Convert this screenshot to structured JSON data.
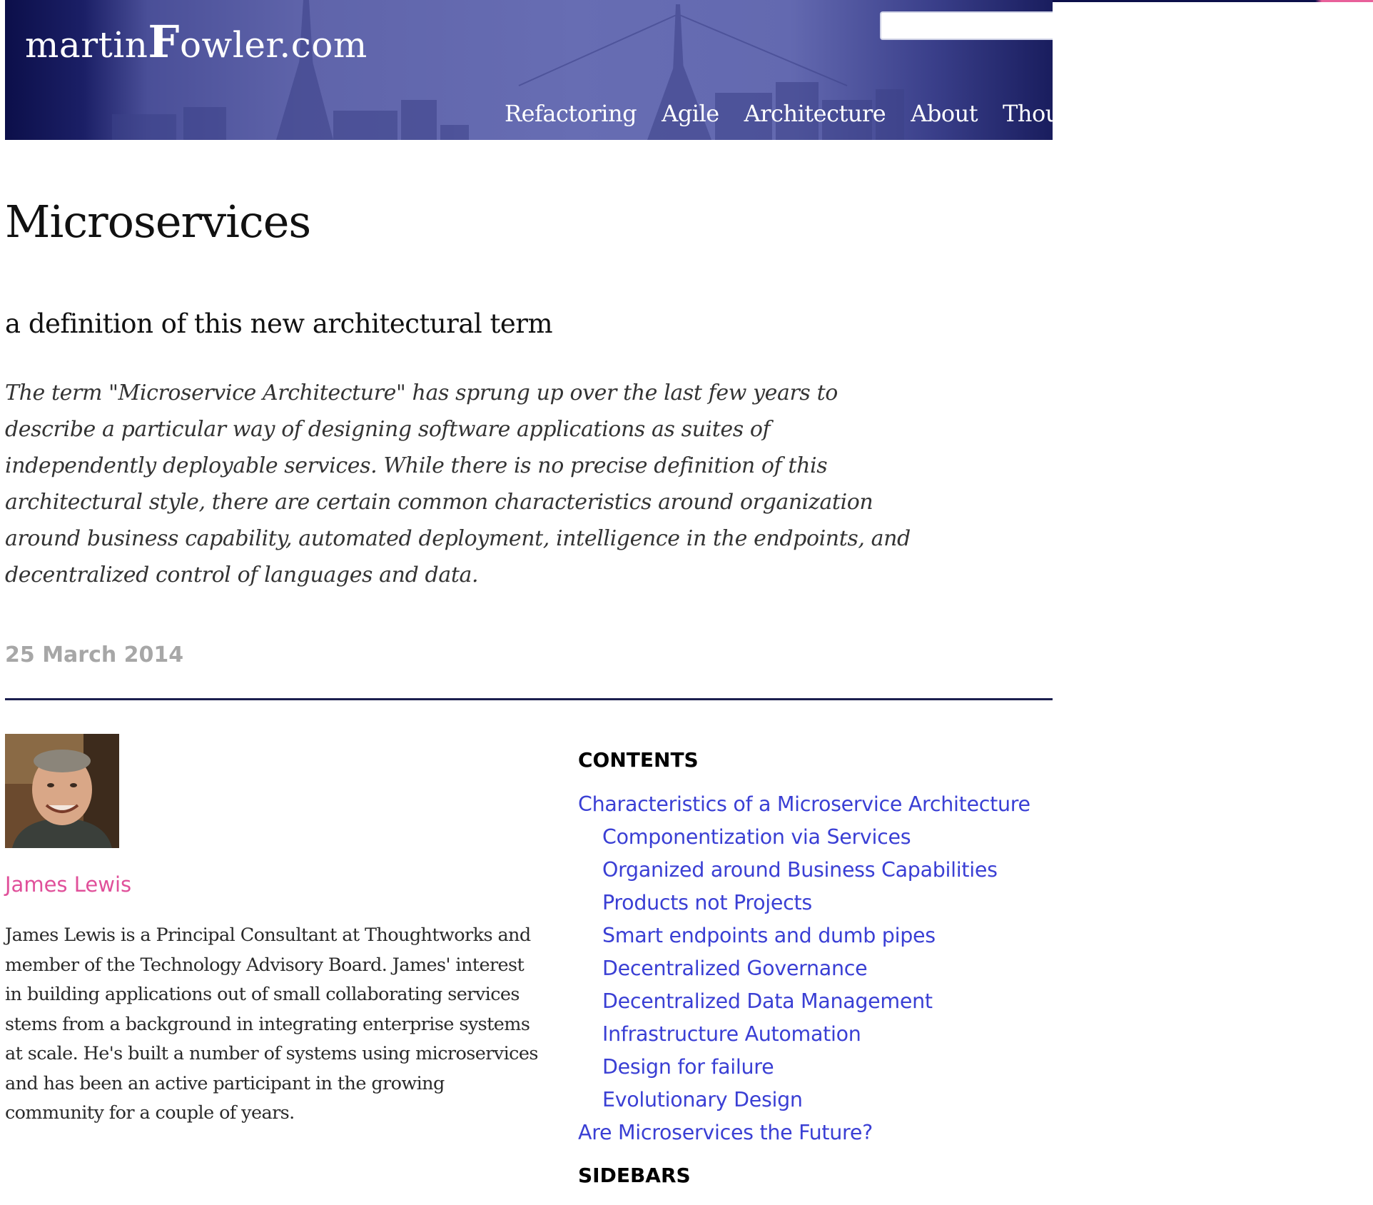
{
  "header": {
    "logo_prefix": "martin",
    "logo_f": "F",
    "logo_suffix": "owler.com",
    "search_value": "",
    "nav": [
      "Refactoring",
      "Agile",
      "Architecture",
      "About",
      "Thoughtworks"
    ]
  },
  "article": {
    "title": "Microservices",
    "subtitle": "a definition of this new architectural term",
    "abstract": "The term \"Microservice Architecture\" has sprung up over the last few years to describe a particular way of designing software applications as suites of independently deployable services. While there is no precise definition of this architectural style, there are certain common characteristics around organization around business capability, automated deployment, intelligence in the endpoints, and decentralized control of languages and data.",
    "date": "25 March 2014"
  },
  "author": {
    "name": "James Lewis",
    "bio": "James Lewis is a Principal Consultant at Thoughtworks and member of the Technology Advisory Board. James' interest in building applications out of small collaborating services stems from a background in integrating enterprise systems at scale. He's built a number of systems using microservices and has been an active participant in the growing community for a couple of years."
  },
  "toc": {
    "heading": "CONTENTS",
    "items": [
      {
        "label": "Characteristics of a Microservice Architecture",
        "level": 1
      },
      {
        "label": "Componentization via Services",
        "level": 2
      },
      {
        "label": "Organized around Business Capabilities",
        "level": 2
      },
      {
        "label": "Products not Projects",
        "level": 2
      },
      {
        "label": "Smart endpoints and dumb pipes",
        "level": 2
      },
      {
        "label": "Decentralized Governance",
        "level": 2
      },
      {
        "label": "Decentralized Data Management",
        "level": 2
      },
      {
        "label": "Infrastructure Automation",
        "level": 2
      },
      {
        "label": "Design for failure",
        "level": 2
      },
      {
        "label": "Evolutionary Design",
        "level": 2
      },
      {
        "label": "Are Microservices the Future?",
        "level": 1
      }
    ],
    "sidebars_heading": "SIDEBARS"
  },
  "colors": {
    "banner_dark": "#0c0f4a",
    "banner_mid": "#676db3",
    "link": "#3a3fd4",
    "author": "#e0509a",
    "date": "#a7a7a7"
  }
}
